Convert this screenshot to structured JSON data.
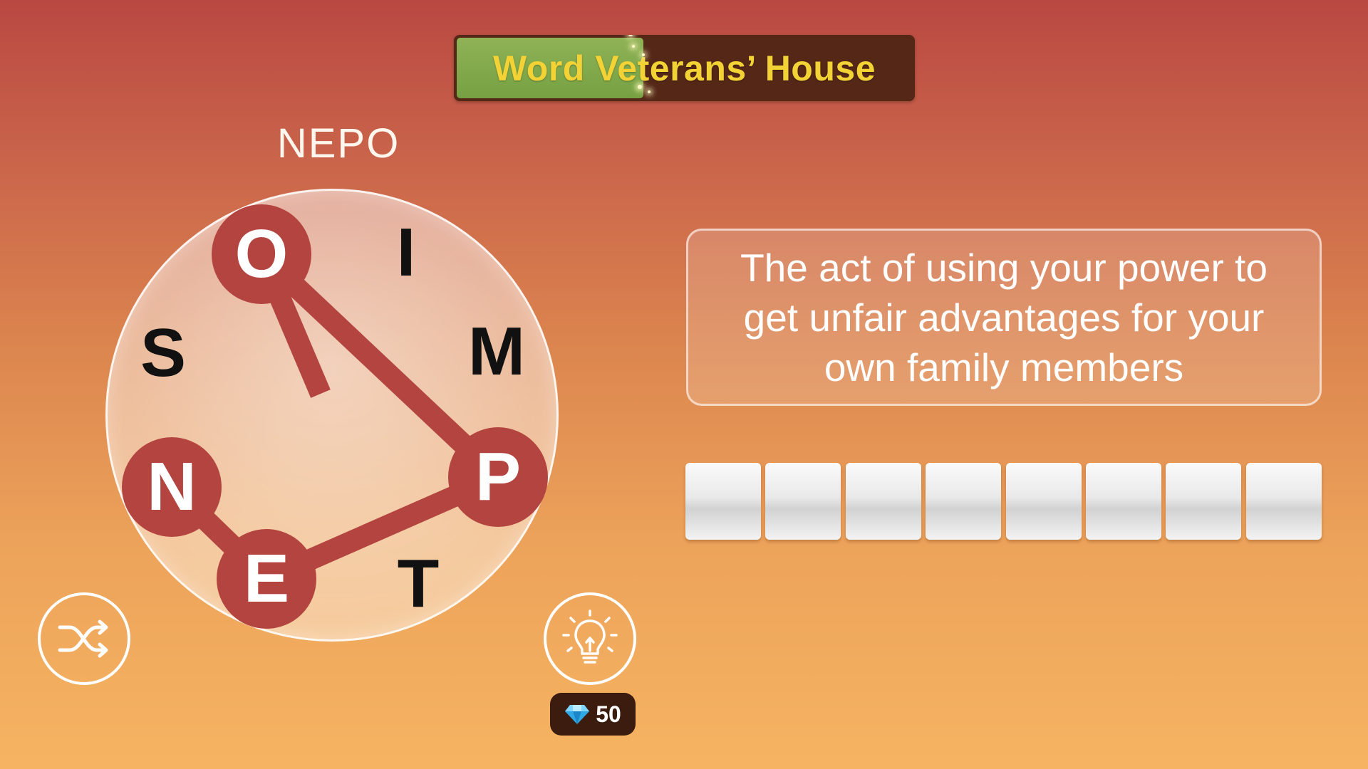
{
  "level": {
    "title": "Word Veterans’ House",
    "progress": 0.41
  },
  "current_word": "NEPO",
  "wheel": {
    "letters": [
      {
        "char": "O",
        "selected": true
      },
      {
        "char": "I",
        "selected": false
      },
      {
        "char": "M",
        "selected": false
      },
      {
        "char": "P",
        "selected": true
      },
      {
        "char": "T",
        "selected": false
      },
      {
        "char": "E",
        "selected": true
      },
      {
        "char": "N",
        "selected": true
      },
      {
        "char": "S",
        "selected": false
      }
    ]
  },
  "clue": {
    "text": "The act of using your power to get unfair advantages for your own family members"
  },
  "answer": {
    "length": 8,
    "slots": [
      "",
      "",
      "",
      "",
      "",
      "",
      "",
      ""
    ]
  },
  "hint": {
    "gems": "50",
    "icon": "lightbulb-icon"
  },
  "shuffle": {
    "icon": "shuffle-icon"
  },
  "colors": {
    "accent": "#b4443f",
    "title_text": "#f2d234",
    "progress_fill": "#7ea646",
    "bar_background": "#542717"
  }
}
